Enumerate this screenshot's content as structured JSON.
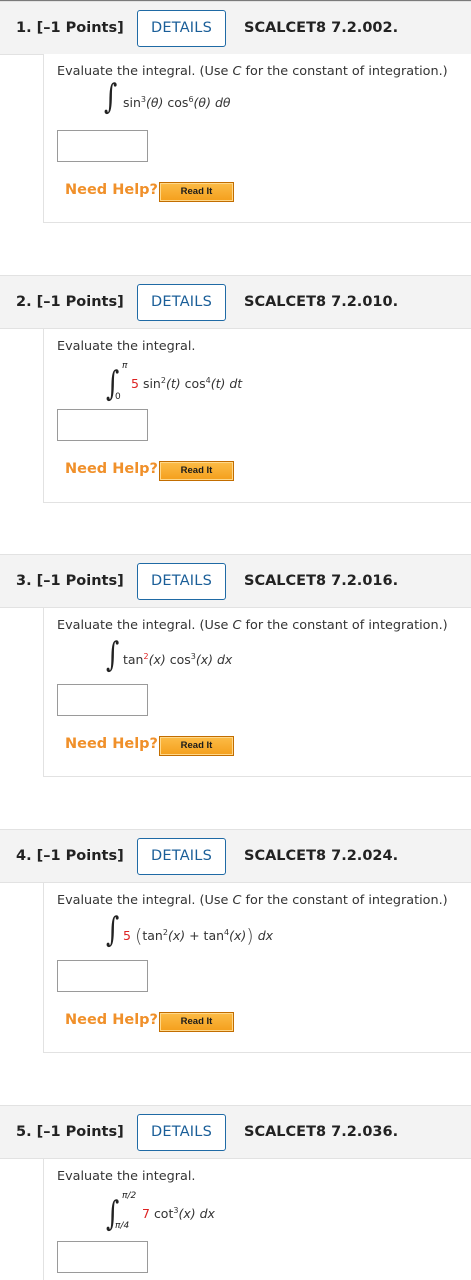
{
  "questions": [
    {
      "title": "1. [–1 Points]",
      "details_label": "DETAILS",
      "code": "SCALCET8 7.2.002.",
      "prompt_main": "Evaluate the integral. (Use ",
      "prompt_const": "C",
      "prompt_tail": " for the constant of integration.)",
      "integrand": {
        "f1": "sin",
        "e1": "3",
        "a1": "(θ)",
        "f2": "cos",
        "e2": "6",
        "a2": "(θ)",
        "d": "dθ"
      },
      "need_help": "Need Help?",
      "read_it": "Read It"
    },
    {
      "title": "2. [–1 Points]",
      "details_label": "DETAILS",
      "code": "SCALCET8 7.2.010.",
      "prompt_main": "Evaluate the integral.",
      "upper_limit": "π",
      "lower_limit": "0",
      "integrand": {
        "coef": "5",
        "f1": "sin",
        "e1": "2",
        "a1": "(t)",
        "f2": "cos",
        "e2": "4",
        "a2": "(t)",
        "d": "dt"
      },
      "need_help": "Need Help?",
      "read_it": "Read It"
    },
    {
      "title": "3. [–1 Points]",
      "details_label": "DETAILS",
      "code": "SCALCET8 7.2.016.",
      "prompt_main": "Evaluate the integral. (Use ",
      "prompt_const": "C",
      "prompt_tail": " for the constant of integration.)",
      "integrand": {
        "f1": "tan",
        "e1": "2",
        "a1": "(x)",
        "f2": "cos",
        "e2": "3",
        "a2": "(x)",
        "d": "dx"
      },
      "need_help": "Need Help?",
      "read_it": "Read It"
    },
    {
      "title": "4. [–1 Points]",
      "details_label": "DETAILS",
      "code": "SCALCET8 7.2.024.",
      "prompt_main": "Evaluate the integral. (Use ",
      "prompt_const": "C",
      "prompt_tail": " for the constant of integration.)",
      "integrand": {
        "coef": "5",
        "f1": "tan",
        "e1": "2",
        "a1": "(x)",
        "op": "+",
        "f2": "tan",
        "e2": "4",
        "a2": "(x)",
        "d": "dx"
      },
      "need_help": "Need Help?",
      "read_it": "Read It"
    },
    {
      "title": "5. [–1 Points]",
      "details_label": "DETAILS",
      "code": "SCALCET8 7.2.036.",
      "prompt_main": "Evaluate the integral.",
      "upper_limit": "π/2",
      "lower_limit": "π/4",
      "integrand": {
        "coef": "7",
        "f1": "cot",
        "e1": "3",
        "a1": "(x)",
        "d": "dx"
      }
    }
  ]
}
